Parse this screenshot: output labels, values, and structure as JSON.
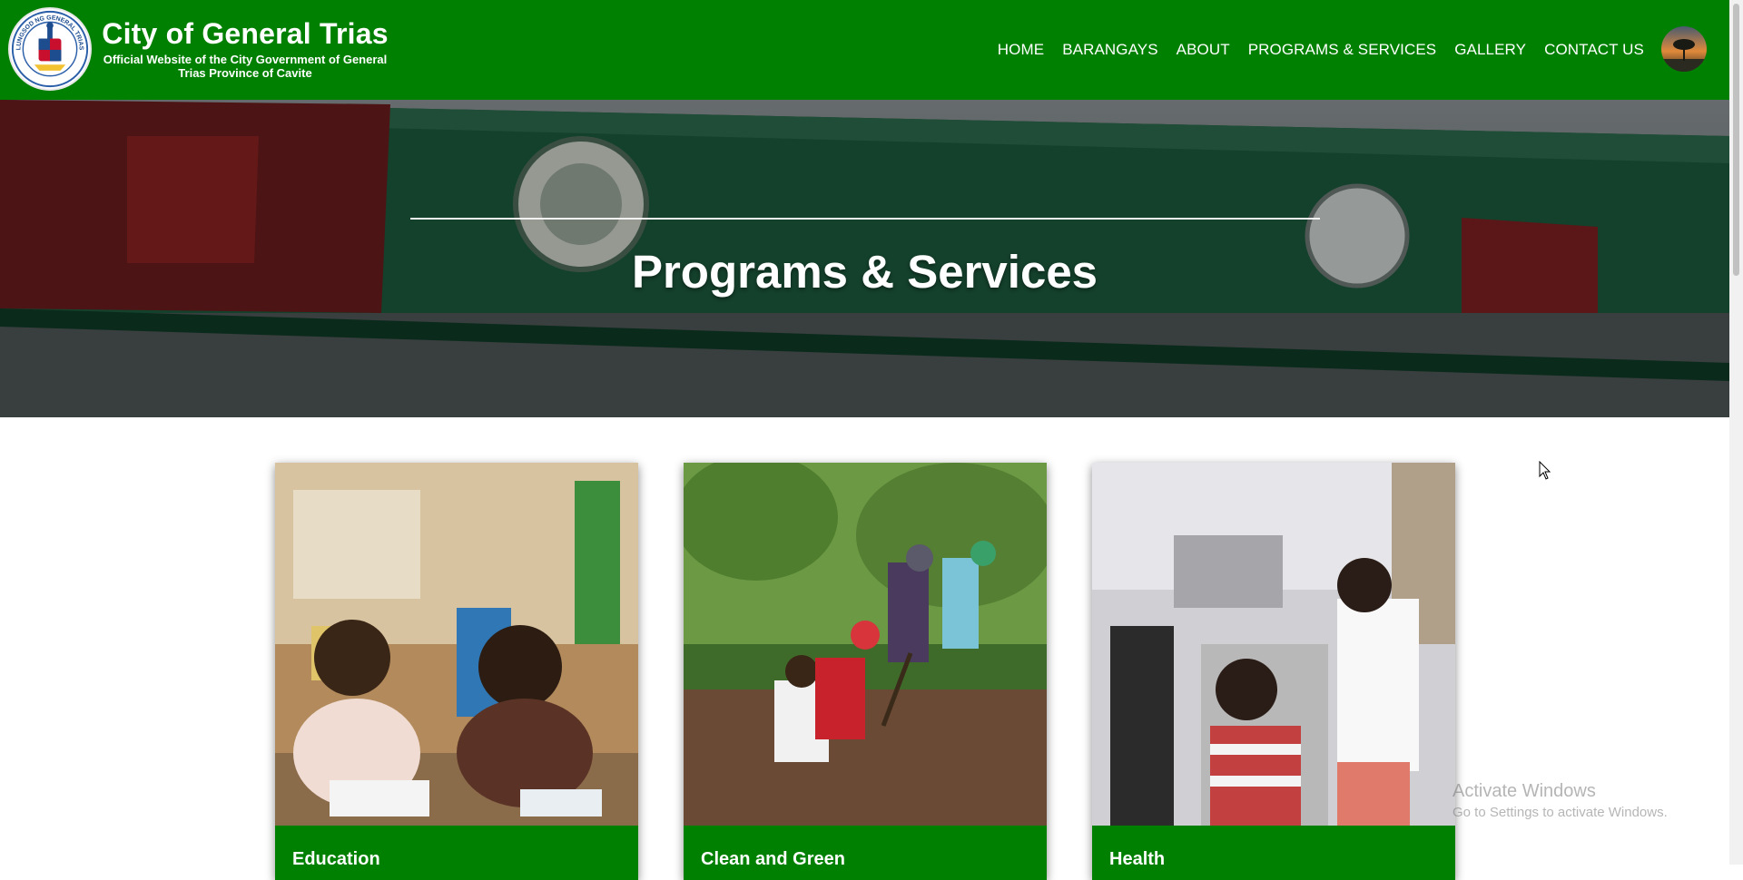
{
  "header": {
    "site_name": "City of General Trias",
    "tagline": "Official Website of the City Government of General Trias Province of Cavite",
    "logo_text": "LUNGSOD NG GENERAL TRIAS",
    "logo_icon": "city-seal",
    "avatar_icon": "sunset-tree-avatar",
    "brand_color": "#008000"
  },
  "nav": {
    "items": [
      {
        "label": "HOME"
      },
      {
        "label": "BARANGAYS"
      },
      {
        "label": "ABOUT"
      },
      {
        "label": "PROGRAMS & SERVICES"
      },
      {
        "label": "GALLERY"
      },
      {
        "label": "CONTACT US"
      }
    ]
  },
  "hero": {
    "title": "Programs & Services"
  },
  "cards": [
    {
      "label": "Education"
    },
    {
      "label": "Clean and Green"
    },
    {
      "label": "Health"
    }
  ],
  "os_watermark": {
    "line1": "Activate Windows",
    "line2": "Go to Settings to activate Windows."
  }
}
